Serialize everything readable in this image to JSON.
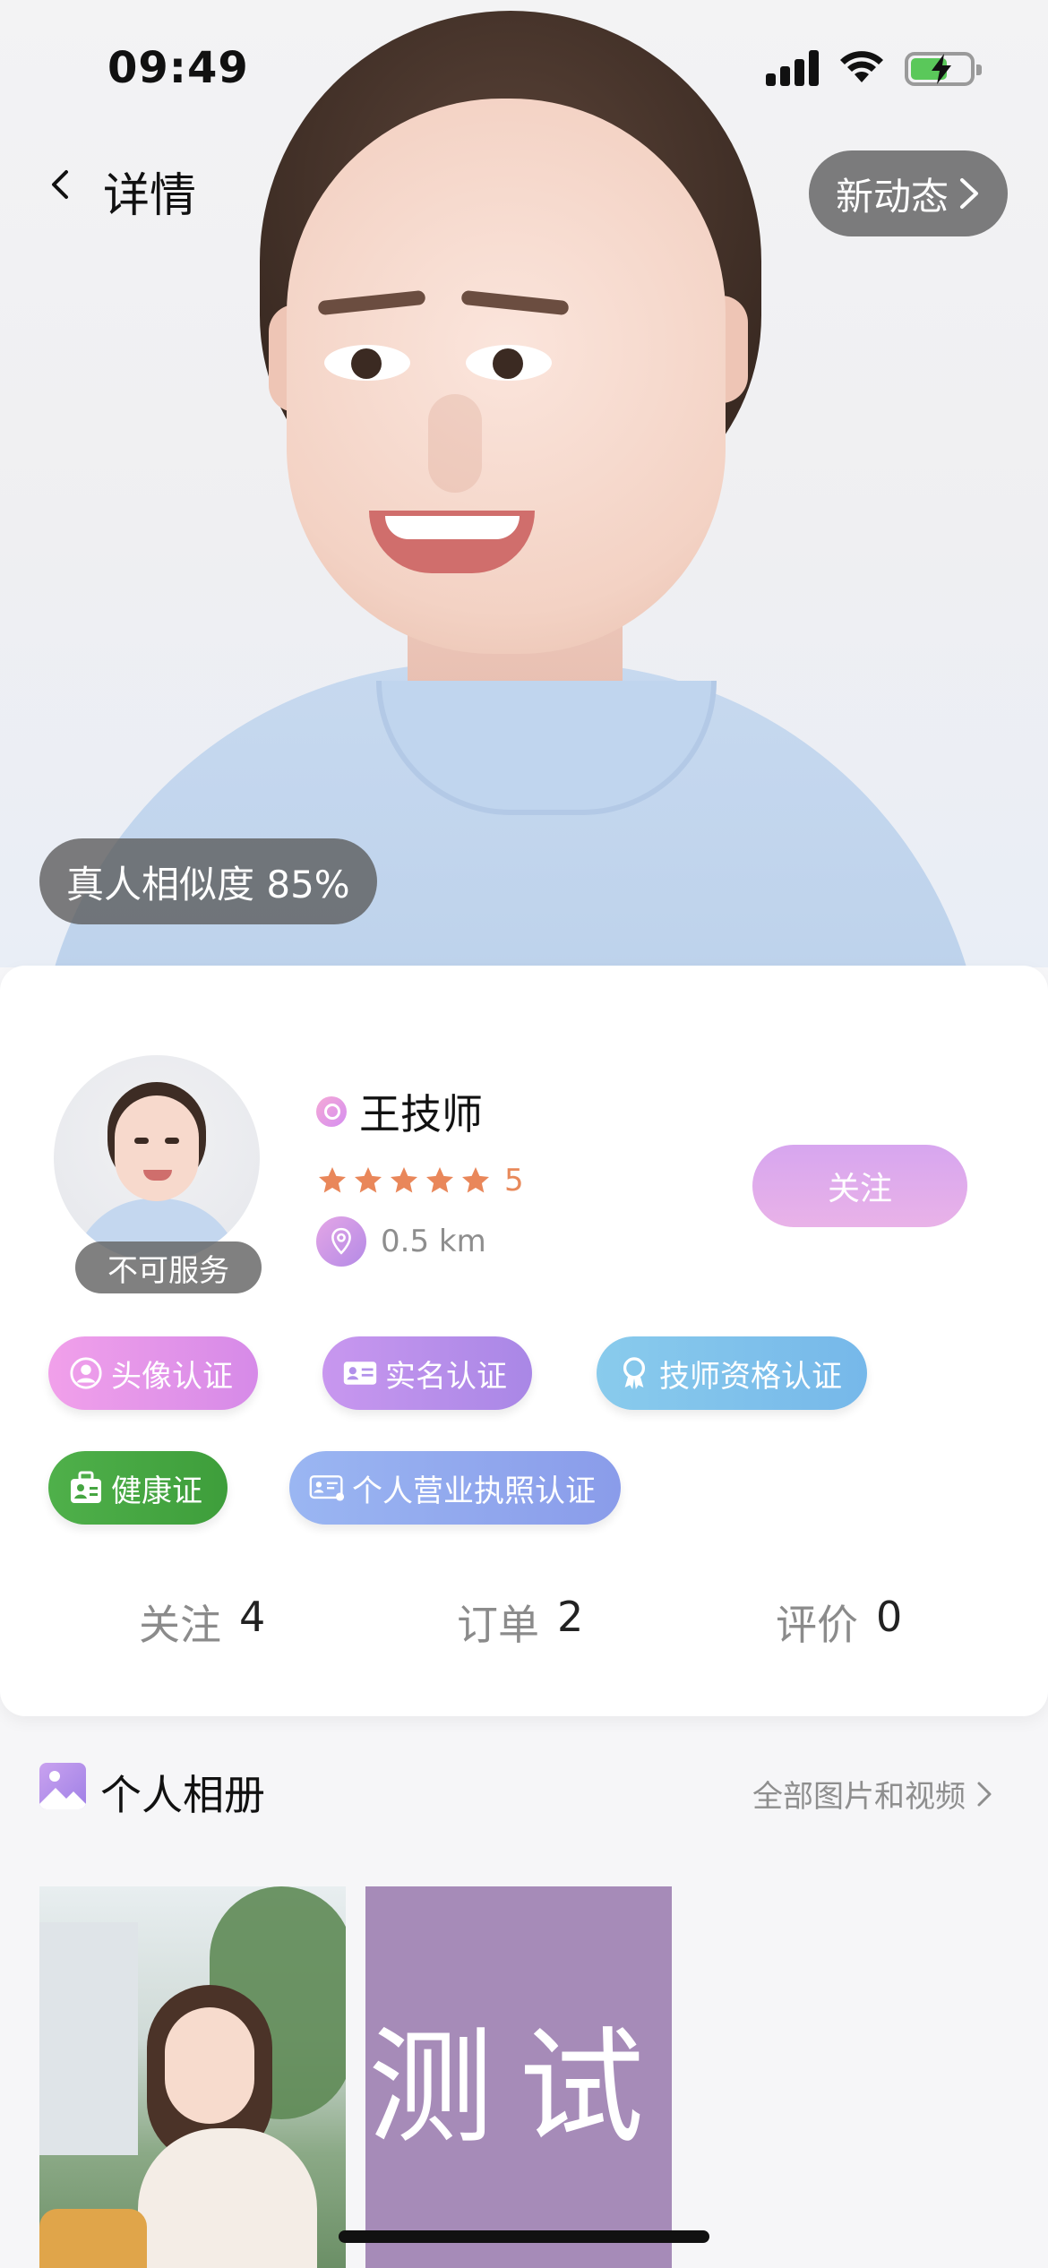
{
  "status_bar": {
    "time": "09:49"
  },
  "nav": {
    "title": "详情",
    "new_feed": "新动态"
  },
  "hero": {
    "similarity_label": "真人相似度 85%"
  },
  "profile": {
    "name": "王技师",
    "rating": "5",
    "distance": "0.5 km",
    "availability": "不可服务",
    "follow_label": "关注"
  },
  "badges": [
    {
      "label": "头像认证",
      "icon": "user-circle-icon",
      "color": "#e59ae9"
    },
    {
      "label": "实名认证",
      "icon": "id-card-icon",
      "color": "#b68fe9"
    },
    {
      "label": "技师资格认证",
      "icon": "award-ribbon-icon",
      "color": "#80c2eb"
    },
    {
      "label": "健康证",
      "icon": "medical-kit-icon",
      "color": "#47a843"
    },
    {
      "label": "个人营业执照认证",
      "icon": "license-card-icon",
      "color": "#93a9ee"
    }
  ],
  "stats": [
    {
      "label": "关注",
      "value": "4"
    },
    {
      "label": "订单",
      "value": "2"
    },
    {
      "label": "评价",
      "value": "0"
    }
  ],
  "album": {
    "title": "个人相册",
    "view_all": "全部图片和视频",
    "photo2_text": "测试"
  }
}
